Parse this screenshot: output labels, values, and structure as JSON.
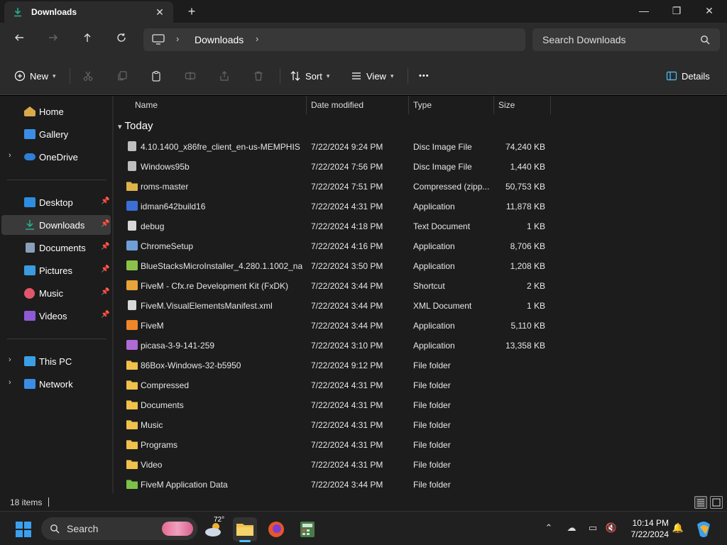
{
  "window": {
    "tab_title": "Downloads",
    "close_tab": "✕",
    "new_tab": "+",
    "minimize": "—",
    "maximize": "❐",
    "close": "✕"
  },
  "address": {
    "path": "Downloads",
    "search_placeholder": "Search Downloads"
  },
  "commands": {
    "new": "New",
    "sort": "Sort",
    "view": "View",
    "more": "•••",
    "details": "Details"
  },
  "sidebar": {
    "items": [
      {
        "label": "Home",
        "icon": "home-icon",
        "color": "#d9a94a"
      },
      {
        "label": "Gallery",
        "icon": "gallery-icon",
        "color": "#3a8ee6"
      },
      {
        "label": "OneDrive",
        "icon": "onedrive-icon",
        "color": "#2f7fd6"
      },
      {
        "label": "Desktop",
        "icon": "desktop-icon",
        "color": "#2d8de0"
      },
      {
        "label": "Downloads",
        "icon": "download-icon",
        "color": "#27ae8b"
      },
      {
        "label": "Documents",
        "icon": "documents-icon",
        "color": "#8aa0b8"
      },
      {
        "label": "Pictures",
        "icon": "pictures-icon",
        "color": "#3a9be0"
      },
      {
        "label": "Music",
        "icon": "music-icon",
        "color": "#e2566b"
      },
      {
        "label": "Videos",
        "icon": "videos-icon",
        "color": "#8e5ad6"
      },
      {
        "label": "This PC",
        "icon": "this-pc-icon",
        "color": "#3aa0e6"
      },
      {
        "label": "Network",
        "icon": "network-icon",
        "color": "#3a8ee6"
      }
    ]
  },
  "columns": {
    "name": "Name",
    "date": "Date modified",
    "type": "Type",
    "size": "Size"
  },
  "group": "Today",
  "files": [
    {
      "name": "4.10.1400_x86fre_client_en-us-MEMPHIS",
      "date": "7/22/2024 9:24 PM",
      "type": "Disc Image File",
      "size": "74,240 KB",
      "icon": "disc-image-icon",
      "color": "#bfbfbf"
    },
    {
      "name": "Windows95b",
      "date": "7/22/2024 7:56 PM",
      "type": "Disc Image File",
      "size": "1,440 KB",
      "icon": "disc-image-icon",
      "color": "#bfbfbf"
    },
    {
      "name": "roms-master",
      "date": "7/22/2024 7:51 PM",
      "type": "Compressed (zipp...",
      "size": "50,753 KB",
      "icon": "zip-folder-icon",
      "color": "#e0b34a"
    },
    {
      "name": "idman642build16",
      "date": "7/22/2024 4:31 PM",
      "type": "Application",
      "size": "11,878 KB",
      "icon": "app-icon",
      "color": "#3b6fd6"
    },
    {
      "name": "debug",
      "date": "7/22/2024 4:18 PM",
      "type": "Text Document",
      "size": "1 KB",
      "icon": "text-file-icon",
      "color": "#d8d8d8"
    },
    {
      "name": "ChromeSetup",
      "date": "7/22/2024 4:16 PM",
      "type": "Application",
      "size": "8,706 KB",
      "icon": "app-icon",
      "color": "#6e9fd6"
    },
    {
      "name": "BlueStacksMicroInstaller_4.280.1.1002_na...",
      "date": "7/22/2024 3:50 PM",
      "type": "Application",
      "size": "1,208 KB",
      "icon": "app-icon",
      "color": "#8bc34a"
    },
    {
      "name": "FiveM - Cfx.re Development Kit (FxDK)",
      "date": "7/22/2024 3:44 PM",
      "type": "Shortcut",
      "size": "2 KB",
      "icon": "shortcut-icon",
      "color": "#e8a33a"
    },
    {
      "name": "FiveM.VisualElementsManifest.xml",
      "date": "7/22/2024 3:44 PM",
      "type": "XML Document",
      "size": "1 KB",
      "icon": "xml-file-icon",
      "color": "#d8d8d8"
    },
    {
      "name": "FiveM",
      "date": "7/22/2024 3:44 PM",
      "type": "Application",
      "size": "5,110 KB",
      "icon": "app-icon",
      "color": "#f0862a"
    },
    {
      "name": "picasa-3-9-141-259",
      "date": "7/22/2024 3:10 PM",
      "type": "Application",
      "size": "13,358 KB",
      "icon": "app-icon",
      "color": "#b06ad6"
    },
    {
      "name": "86Box-Windows-32-b5950",
      "date": "7/22/2024 9:12 PM",
      "type": "File folder",
      "size": "",
      "icon": "folder-icon",
      "color": "#f0c14b"
    },
    {
      "name": "Compressed",
      "date": "7/22/2024 4:31 PM",
      "type": "File folder",
      "size": "",
      "icon": "folder-icon",
      "color": "#f0c14b"
    },
    {
      "name": "Documents",
      "date": "7/22/2024 4:31 PM",
      "type": "File folder",
      "size": "",
      "icon": "folder-icon",
      "color": "#f0c14b"
    },
    {
      "name": "Music",
      "date": "7/22/2024 4:31 PM",
      "type": "File folder",
      "size": "",
      "icon": "folder-icon",
      "color": "#f0c14b"
    },
    {
      "name": "Programs",
      "date": "7/22/2024 4:31 PM",
      "type": "File folder",
      "size": "",
      "icon": "folder-icon",
      "color": "#f0c14b"
    },
    {
      "name": "Video",
      "date": "7/22/2024 4:31 PM",
      "type": "File folder",
      "size": "",
      "icon": "folder-icon",
      "color": "#f0c14b"
    },
    {
      "name": "FiveM Application Data",
      "date": "7/22/2024 3:44 PM",
      "type": "File folder",
      "size": "",
      "icon": "folder-icon",
      "color": "#7cc04a"
    }
  ],
  "status": {
    "item_count": "18 items"
  },
  "taskbar": {
    "search_label": "Search",
    "weather_temp": "72°",
    "time": "10:14 PM",
    "date": "7/22/2024"
  },
  "colors": {
    "accent": "#4cc2ff",
    "selected_bg": "#3a3a3a",
    "folder": "#f0c14b"
  }
}
